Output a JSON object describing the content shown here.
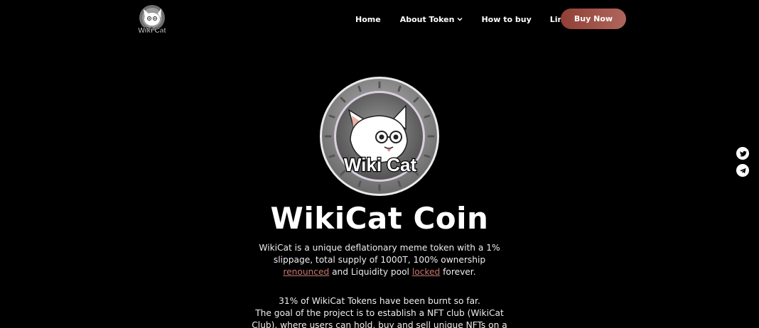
{
  "brand": {
    "logo_text": "Wiki Cat",
    "coin_text": "Wiki Cat"
  },
  "nav": {
    "home": "Home",
    "about": "About Token",
    "howto": "How to buy",
    "links": "Links",
    "buy": "Buy Now"
  },
  "hero": {
    "title": "WikiCat Coin",
    "desc_part1": "WikiCat is a unique deflationary meme token with a 1% slippage, total supply of 1000T, 100% ownership ",
    "desc_link1": "renounced",
    "desc_part2": " and Liquidity pool ",
    "desc_link2": "locked",
    "desc_part3": " forever.",
    "burn_line": "31% of WikiCat Tokens have been burnt so far.",
    "goal_line": "The goal of the project is to establish a NFT club (WikiCat Club), where users can hold, buy and sell unique NFTs on a"
  },
  "social": {
    "twitter_icon": "twitter-icon",
    "telegram_icon": "telegram-icon"
  },
  "colors": {
    "background": "#000000",
    "accent": "#c4776b",
    "button_start": "#8f3f36",
    "button_end": "#b0665c"
  }
}
